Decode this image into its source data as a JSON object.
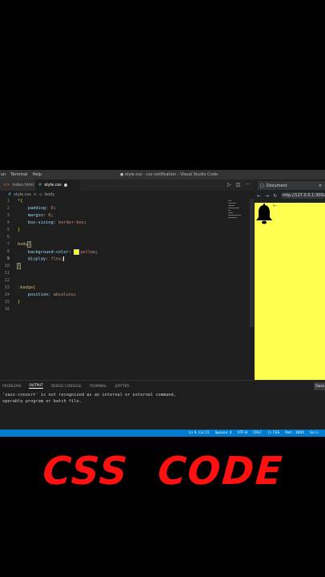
{
  "titlebar": {
    "menu": [
      "un",
      "Terminal",
      "Help"
    ],
    "window_title": "● style.css - css notification - Visual Studio Code"
  },
  "tabs": [
    {
      "label": "index.html",
      "icon": "html-file-icon"
    },
    {
      "label": "style.css",
      "icon": "css-file-icon",
      "active": true
    }
  ],
  "breadcrumb": {
    "file": "style.css",
    "sep": ">",
    "symbol": "body"
  },
  "code": {
    "lines": [
      {
        "n": "1",
        "text": "*{"
      },
      {
        "n": "2",
        "text": "    padding: 0;"
      },
      {
        "n": "3",
        "text": "    margin: 0;"
      },
      {
        "n": "4",
        "text": "    box-sizing: border-box;"
      },
      {
        "n": "5",
        "text": "}"
      },
      {
        "n": "6",
        "text": ""
      },
      {
        "n": "7",
        "text": "body{"
      },
      {
        "n": "8",
        "text": "    background-color: yellow;"
      },
      {
        "n": "9",
        "text": "    display: flex;"
      },
      {
        "n": "10",
        "text": "}"
      },
      {
        "n": "11",
        "text": ""
      },
      {
        "n": "12",
        "text": ""
      },
      {
        "n": "13",
        "text": ".badge{"
      },
      {
        "n": "14",
        "text": "    position: absolute;"
      },
      {
        "n": "15",
        "text": "}"
      },
      {
        "n": "16",
        "text": ""
      }
    ]
  },
  "browser": {
    "tab_title": "Document",
    "url": "http://127.0.0.1:3000",
    "badge_text": "9+",
    "viewport_color": "#ffff50"
  },
  "panel": {
    "tabs": [
      "PROBLEMS",
      "OUTPUT",
      "DEBUG CONSOLE",
      "TERMINAL",
      "JUPYTER"
    ],
    "active_tab": "OUTPUT",
    "button": "Sass",
    "output_lines": [
      "'sass-convert' is not recognized as an internal or external command,",
      "operable program or batch file."
    ]
  },
  "statusbar": {
    "items": [
      "Ln 9, Col 15",
      "Spaces: 4",
      "UTF-8",
      "CRLF",
      "{} CSS",
      "Port : 3000",
      "Go Li"
    ]
  },
  "overlay": {
    "text": "CSS CODE",
    "color": "#ff1111"
  }
}
